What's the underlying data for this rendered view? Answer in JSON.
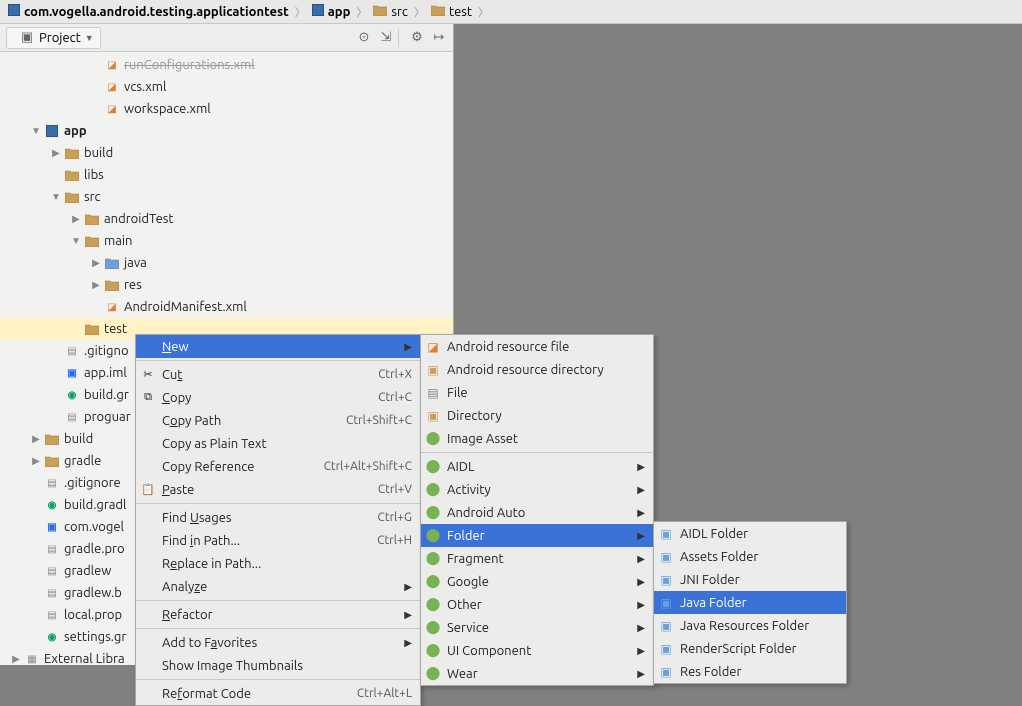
{
  "breadcrumb": [
    {
      "icon": "module",
      "label": "com.vogella.android.testing.applicationtest",
      "bold": true
    },
    {
      "icon": "module",
      "label": "app",
      "bold": true
    },
    {
      "icon": "folder",
      "label": "src"
    },
    {
      "icon": "folder",
      "label": "test"
    }
  ],
  "project": {
    "selector": "Project",
    "tree": [
      {
        "indent": 4,
        "arrow": "",
        "icon": "xml-orange",
        "label": "runConfigurations.xml",
        "cut": true
      },
      {
        "indent": 4,
        "arrow": "",
        "icon": "xml-orange",
        "label": "vcs.xml"
      },
      {
        "indent": 4,
        "arrow": "",
        "icon": "xml-orange",
        "label": "workspace.xml"
      },
      {
        "indent": 1,
        "arrow": "down",
        "icon": "module",
        "label": "app",
        "bold": true
      },
      {
        "indent": 2,
        "arrow": "right",
        "icon": "folder",
        "label": "build"
      },
      {
        "indent": 2,
        "arrow": "",
        "icon": "folder",
        "label": "libs"
      },
      {
        "indent": 2,
        "arrow": "down",
        "icon": "folder",
        "label": "src"
      },
      {
        "indent": 3,
        "arrow": "right",
        "icon": "folder",
        "label": "androidTest"
      },
      {
        "indent": 3,
        "arrow": "down",
        "icon": "folder",
        "label": "main"
      },
      {
        "indent": 4,
        "arrow": "right",
        "icon": "folder-blue",
        "label": "java"
      },
      {
        "indent": 4,
        "arrow": "right",
        "icon": "folder",
        "label": "res"
      },
      {
        "indent": 4,
        "arrow": "",
        "icon": "xml-orange",
        "label": "AndroidManifest.xml"
      },
      {
        "indent": 3,
        "arrow": "",
        "icon": "folder",
        "label": "test",
        "selected": true
      },
      {
        "indent": 2,
        "arrow": "",
        "icon": "file",
        "label": ".gitigno"
      },
      {
        "indent": 2,
        "arrow": "",
        "icon": "gradle-blue",
        "label": "app.iml"
      },
      {
        "indent": 2,
        "arrow": "",
        "icon": "gradle",
        "label": "build.gr"
      },
      {
        "indent": 2,
        "arrow": "",
        "icon": "file",
        "label": "proguar"
      },
      {
        "indent": 1,
        "arrow": "right",
        "icon": "folder",
        "label": "build"
      },
      {
        "indent": 1,
        "arrow": "right",
        "icon": "folder",
        "label": "gradle"
      },
      {
        "indent": 1,
        "arrow": "",
        "icon": "file",
        "label": ".gitignore"
      },
      {
        "indent": 1,
        "arrow": "",
        "icon": "gradle",
        "label": "build.gradl"
      },
      {
        "indent": 1,
        "arrow": "",
        "icon": "gradle-blue",
        "label": "com.vogel"
      },
      {
        "indent": 1,
        "arrow": "",
        "icon": "file",
        "label": "gradle.pro"
      },
      {
        "indent": 1,
        "arrow": "",
        "icon": "file",
        "label": "gradlew"
      },
      {
        "indent": 1,
        "arrow": "",
        "icon": "file",
        "label": "gradlew.b"
      },
      {
        "indent": 1,
        "arrow": "",
        "icon": "file",
        "label": "local.prop"
      },
      {
        "indent": 1,
        "arrow": "",
        "icon": "gradle",
        "label": "settings.gr"
      },
      {
        "indent": 0,
        "arrow": "right",
        "icon": "lib",
        "label": "External Libra"
      }
    ]
  },
  "menu1": [
    {
      "type": "item",
      "label": "New",
      "u": 0,
      "selected": true,
      "sub": true
    },
    {
      "type": "sep"
    },
    {
      "type": "item",
      "icon": "cut",
      "label": "Cut",
      "u": 2,
      "shortcut": "Ctrl+X"
    },
    {
      "type": "item",
      "icon": "copy",
      "label": "Copy",
      "u": 0,
      "shortcut": "Ctrl+C"
    },
    {
      "type": "item",
      "label": "Copy Path",
      "u": 1,
      "shortcut": "Ctrl+Shift+C"
    },
    {
      "type": "item",
      "label": "Copy as Plain Text"
    },
    {
      "type": "item",
      "label": "Copy Reference",
      "shortcut": "Ctrl+Alt+Shift+C"
    },
    {
      "type": "item",
      "icon": "paste",
      "label": "Paste",
      "u": 0,
      "shortcut": "Ctrl+V"
    },
    {
      "type": "sep"
    },
    {
      "type": "item",
      "label": "Find Usages",
      "u": 5,
      "shortcut": "Ctrl+G"
    },
    {
      "type": "item",
      "label": "Find in Path...",
      "u": 5,
      "shortcut": "Ctrl+H"
    },
    {
      "type": "item",
      "label": "Replace in Path...",
      "u": 1
    },
    {
      "type": "item",
      "label": "Analyze",
      "u": 5,
      "sub": true
    },
    {
      "type": "sep"
    },
    {
      "type": "item",
      "label": "Refactor",
      "u": 0,
      "sub": true
    },
    {
      "type": "sep"
    },
    {
      "type": "item",
      "label": "Add to Favorites",
      "u": 8,
      "sub": true
    },
    {
      "type": "item",
      "label": "Show Image Thumbnails"
    },
    {
      "type": "sep"
    },
    {
      "type": "item",
      "label": "Reformat Code",
      "u": 2,
      "shortcut": "Ctrl+Alt+L"
    }
  ],
  "menu2": [
    {
      "type": "item",
      "icon": "img-i",
      "label": "Android resource file"
    },
    {
      "type": "item",
      "icon": "folder-i",
      "label": "Android resource directory"
    },
    {
      "type": "item",
      "icon": "file-i",
      "label": "File"
    },
    {
      "type": "item",
      "icon": "folder-i",
      "label": "Directory"
    },
    {
      "type": "item",
      "icon": "android-i",
      "label": "Image Asset"
    },
    {
      "type": "sep"
    },
    {
      "type": "item",
      "icon": "android-i",
      "label": "AIDL",
      "sub": true
    },
    {
      "type": "item",
      "icon": "android-i",
      "label": "Activity",
      "sub": true
    },
    {
      "type": "item",
      "icon": "android-i",
      "label": "Android Auto",
      "sub": true
    },
    {
      "type": "item",
      "icon": "android-i",
      "label": "Folder",
      "selected": true,
      "sub": true
    },
    {
      "type": "item",
      "icon": "android-i",
      "label": "Fragment",
      "sub": true
    },
    {
      "type": "item",
      "icon": "android-i",
      "label": "Google",
      "sub": true
    },
    {
      "type": "item",
      "icon": "android-i",
      "label": "Other",
      "sub": true
    },
    {
      "type": "item",
      "icon": "android-i",
      "label": "Service",
      "sub": true
    },
    {
      "type": "item",
      "icon": "android-i",
      "label": "UI Component",
      "sub": true
    },
    {
      "type": "item",
      "icon": "android-i",
      "label": "Wear",
      "sub": true
    }
  ],
  "menu3": [
    {
      "type": "item",
      "icon": "folder-bi",
      "label": "AIDL Folder"
    },
    {
      "type": "item",
      "icon": "folder-bi",
      "label": "Assets Folder"
    },
    {
      "type": "item",
      "icon": "folder-bi",
      "label": "JNI Folder"
    },
    {
      "type": "item",
      "icon": "folder-bi",
      "label": "Java Folder",
      "selected": true
    },
    {
      "type": "item",
      "icon": "folder-bi",
      "label": "Java Resources Folder"
    },
    {
      "type": "item",
      "icon": "folder-bi",
      "label": "RenderScript Folder"
    },
    {
      "type": "item",
      "icon": "folder-bi",
      "label": "Res Folder"
    }
  ]
}
